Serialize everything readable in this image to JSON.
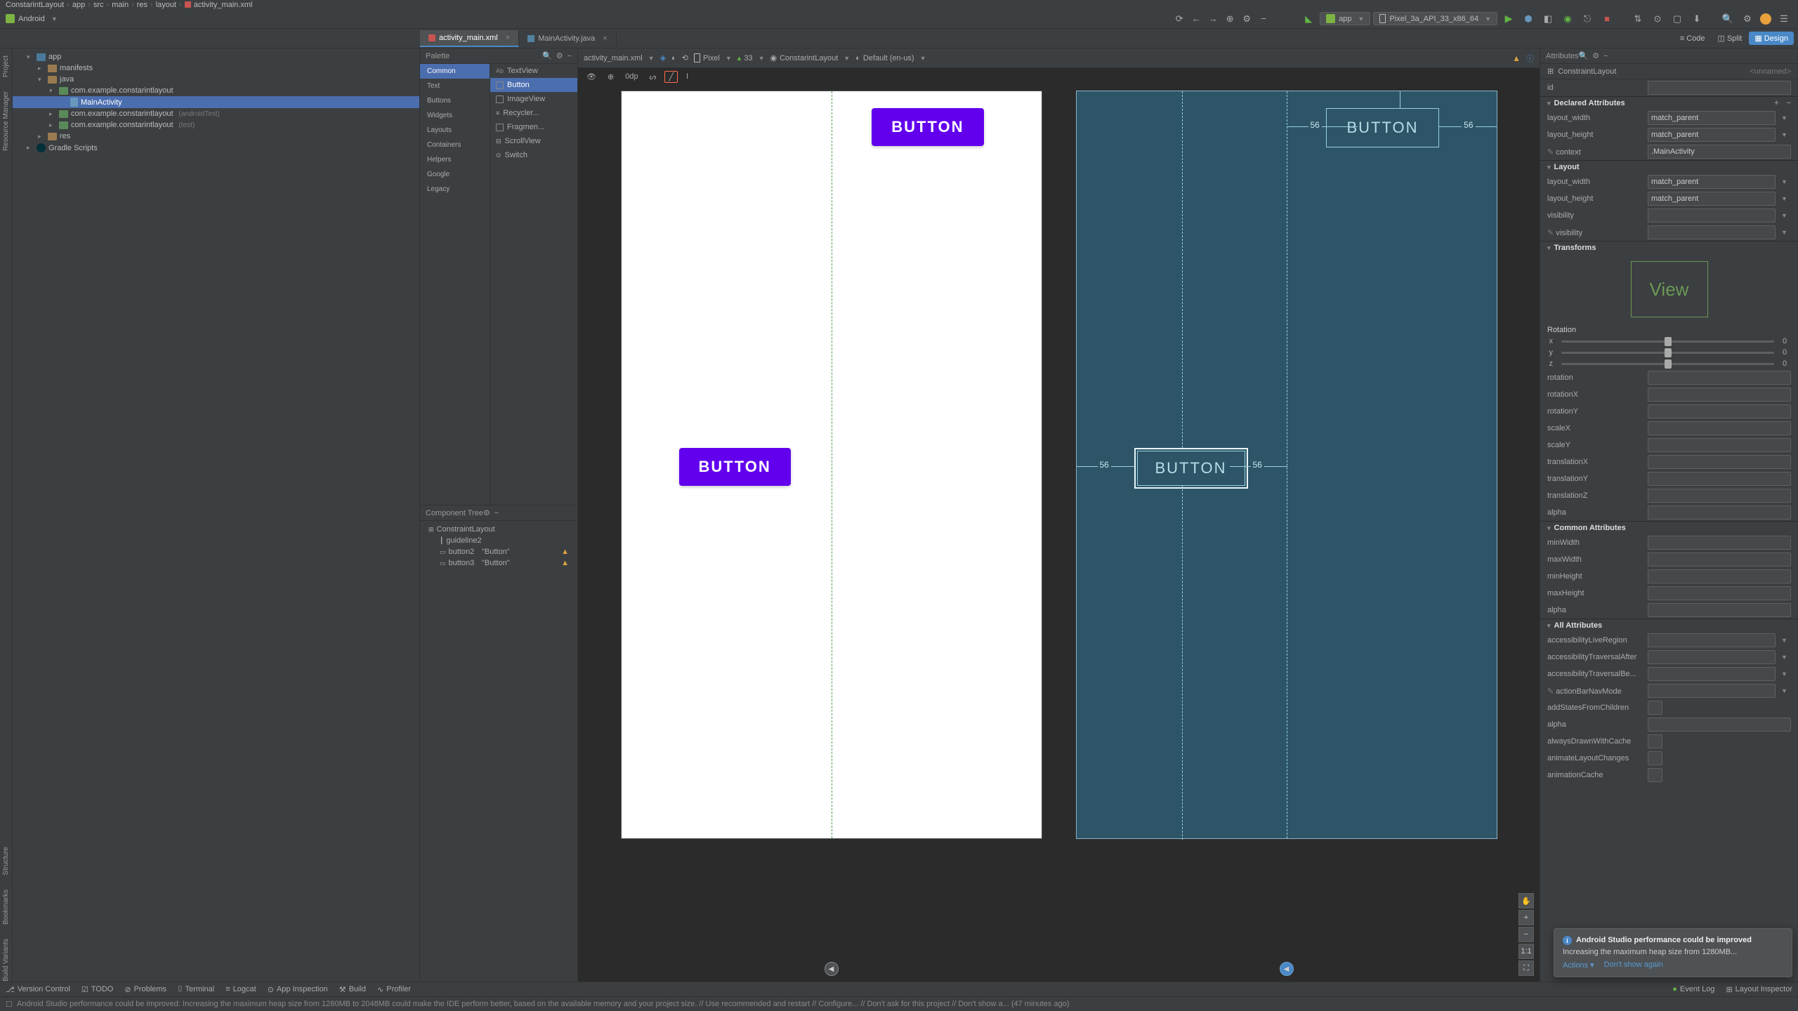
{
  "breadcrumb": [
    "ConstarintLayout",
    "app",
    "src",
    "main",
    "res",
    "layout",
    "activity_main.xml"
  ],
  "project_view": "Android",
  "run_config": "app",
  "device": "Pixel_3a_API_33_x86_64",
  "tabs": [
    {
      "label": "activity_main.xml",
      "active": true,
      "type": "xml"
    },
    {
      "label": "MainActivity.java",
      "active": false,
      "type": "java"
    }
  ],
  "tree": {
    "app": "app",
    "manifests": "manifests",
    "java": "java",
    "pkg1": "com.example.constarintlayout",
    "main_activity": "MainActivity",
    "pkg2": "com.example.constarintlayout",
    "pkg2_hint": "(androidTest)",
    "pkg3": "com.example.constarintlayout",
    "pkg3_hint": "(test)",
    "res": "res",
    "gradle": "Gradle Scripts"
  },
  "palette": {
    "title": "Palette",
    "categories": [
      "Common",
      "Text",
      "Buttons",
      "Widgets",
      "Layouts",
      "Containers",
      "Helpers",
      "Google",
      "Legacy"
    ],
    "items": [
      "TextView",
      "Button",
      "ImageView",
      "Recycler...",
      "Fragmen...",
      "ScrollView",
      "Switch"
    ]
  },
  "comp_tree": {
    "title": "Component Tree",
    "root": "ConstraintLayout",
    "items": [
      {
        "name": "guideline2",
        "hint": ""
      },
      {
        "name": "button2",
        "hint": "\"Button\"",
        "warn": true
      },
      {
        "name": "button3",
        "hint": "\"Button\"",
        "warn": true
      }
    ]
  },
  "design_toolbar": {
    "file": "activity_main.xml",
    "device": "Pixel",
    "api": "33",
    "theme": "ConstarintLayout",
    "locale": "Default (en-us)",
    "margin": "0dp"
  },
  "preview": {
    "btn1_text": "BUTTON",
    "btn2_text": "BUTTON",
    "bp_btn1_text": "BUTTON",
    "bp_btn2_text": "BUTTON",
    "margin_top": "56",
    "margin_end": "56",
    "margin_start_b2": "56",
    "margin_end_b2": "56"
  },
  "view_modes": {
    "code": "Code",
    "split": "Split",
    "design": "Design"
  },
  "attributes": {
    "title": "Attributes",
    "component": "ConstraintLayout",
    "unnamed": "<unnamed>",
    "id_label": "id",
    "sec_declared": "Declared Attributes",
    "layout_width": {
      "label": "layout_width",
      "value": "match_parent"
    },
    "layout_height": {
      "label": "layout_height",
      "value": "match_parent"
    },
    "context": {
      "label": "context",
      "value": ".MainActivity"
    },
    "sec_layout": "Layout",
    "visibility": {
      "label": "visibility",
      "value": ""
    },
    "tools_visibility": {
      "label": "visibility",
      "value": ""
    },
    "sec_transforms": "Transforms",
    "view_label": "View",
    "rotation_label": "Rotation",
    "axes": [
      "x",
      "y",
      "z"
    ],
    "axis_val": "0",
    "fields": [
      "rotation",
      "rotationX",
      "rotationY",
      "scaleX",
      "scaleY",
      "translationX",
      "translationY",
      "translationZ",
      "alpha"
    ],
    "sec_common": "Common Attributes",
    "common_fields": [
      "minWidth",
      "maxWidth",
      "minHeight",
      "maxHeight",
      "alpha"
    ],
    "sec_all": "All Attributes",
    "all_fields": [
      "accessibilityLiveRegion",
      "accessibilityTraversalAfter",
      "accessibilityTraversalBe...",
      "actionBarNavMode",
      "addStatesFromChildren",
      "alpha",
      "alwaysDrawnWithCache",
      "animateLayoutChanges",
      "animationCache"
    ]
  },
  "notification": {
    "title": "Android Studio performance could be improved",
    "body": "Increasing the maximum heap size from 1280MB...",
    "action1": "Actions",
    "action2": "Don't show again"
  },
  "bottom_tools": [
    "Version Control",
    "TODO",
    "Problems",
    "Terminal",
    "Logcat",
    "App Inspection",
    "Build",
    "Profiler"
  ],
  "bottom_right": [
    "Event Log",
    "Layout Inspector"
  ],
  "status": "Android Studio performance could be improved: Increasing the maximum heap size from 1280MB to 2048MB could make the IDE perform better, based on the available memory and your project size. // Use recommended and restart // Configure... // Don't ask for this project // Don't show a... (47 minutes ago)",
  "side_tools_left": [
    "Project",
    "Resource Manager"
  ],
  "side_tools_left2": [
    "Structure",
    "Bookmarks",
    "Build Variants"
  ],
  "zoom": {
    "fit": "1:1"
  }
}
